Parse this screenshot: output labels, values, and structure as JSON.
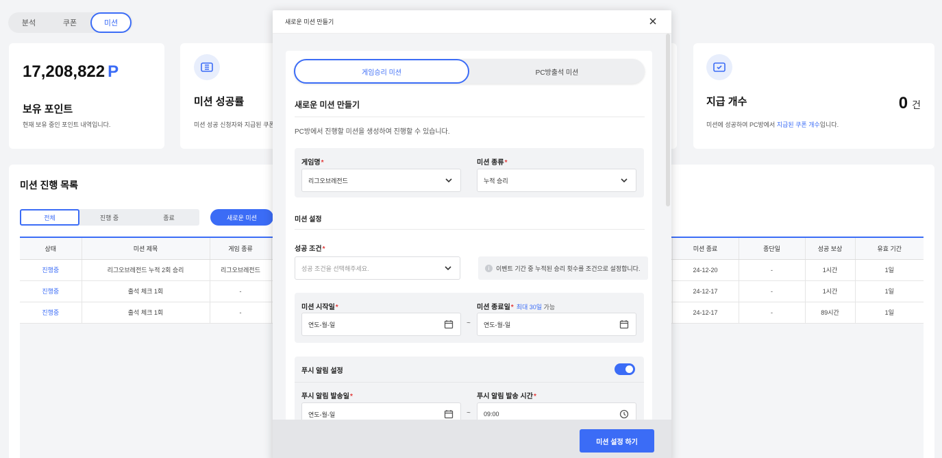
{
  "page_tabs": [
    "분석",
    "쿠폰",
    "미션"
  ],
  "points_card": {
    "value": "17,208,822",
    "unit": "P",
    "title": "보유 포인트",
    "desc": "현재 보유 중인 포인트 내역입니다."
  },
  "success_card": {
    "icon": "ticket-icon",
    "title": "미션 성공률",
    "desc": "미션 성공 신청자와 지급된 쿠폰"
  },
  "issue_card": {
    "icon": "ticket-check-icon",
    "title": "지급 개수",
    "count": "0",
    "unit": "건",
    "desc_prefix": "미션에 성공하여 PC방에서 ",
    "desc_link": "지급된 쿠폰 개수",
    "desc_suffix": "입니다."
  },
  "mission_list": {
    "title": "미션 진행 목록",
    "filters": [
      "전체",
      "진행 중",
      "종료"
    ],
    "new_button": "새로운 미션",
    "columns_left": [
      "상태",
      "미션 제목",
      "게임 종류"
    ],
    "columns_right": [
      "미션 종료",
      "종단일",
      "성공 보상",
      "유효 기간"
    ],
    "rows": [
      {
        "status": "진행중",
        "title": "리그오브레전드 누적 2회 승리",
        "game": "리그오브레전드",
        "end": "24-12-20",
        "stop": "-",
        "reward": "1시간",
        "valid": "1일"
      },
      {
        "status": "진행중",
        "title": "출석 체크 1회",
        "game": "-",
        "end": "24-12-17",
        "stop": "-",
        "reward": "1시간",
        "valid": "1일"
      },
      {
        "status": "진행중",
        "title": "출석 체크 1회",
        "game": "-",
        "end": "24-12-17",
        "stop": "-",
        "reward": "89시간",
        "valid": "1일"
      }
    ]
  },
  "modal": {
    "header_title": "새로운 미션 만들기",
    "type_tabs": [
      "게임승리 미션",
      "PC방출석 미션"
    ],
    "section_title": "새로운 미션 만들기",
    "section_desc": "PC방에서 진행할 미션을 생성하여 진행할 수 있습니다.",
    "game_label": "게임명",
    "game_value": "리그오브레전드",
    "mission_type_label": "미션 종류",
    "mission_type_value": "누적 승리",
    "settings_title": "미션 설정",
    "condition_label": "성공 조건",
    "condition_placeholder": "성공 조건을 선택해주세요.",
    "condition_info": "이벤트 기간 중 누적된 승리 횟수를 조건으로 설정합니다.",
    "start_label": "미션 시작일",
    "end_label": "미션 종료일",
    "end_hint": "최대 30일",
    "end_hint_suffix": " 가능",
    "start_value": "연도-월-일",
    "end_value": "연도-월-일",
    "tilde": "~",
    "push_title": "푸시 알림 설정",
    "push_toggle_on": true,
    "push_date_label": "푸시 알림 발송일",
    "push_date_value": "연도-월-일",
    "push_time_label": "푸시 알림 발송 시간",
    "push_time_value": "09:00",
    "submit": "미션 설정 하기"
  },
  "colors": {
    "accent": "#3b6cf6",
    "required": "#e23b3b",
    "background": "#f3f4f6"
  }
}
